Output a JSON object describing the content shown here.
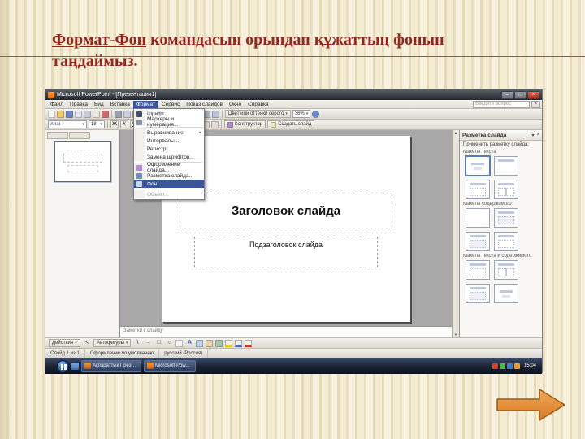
{
  "heading": {
    "link_text": "Формат-Фон",
    "rest_text": " командасын орындап құжаттың фонын таңдаймыз."
  },
  "icons": {
    "minimize": "–",
    "maximize": "□",
    "close": "×",
    "doc_close": "×",
    "dropdown_caret": "▾",
    "submenu_arrow": "▸",
    "bold": "Ж",
    "italic": "К",
    "underline": "Ч",
    "shadow": "S",
    "pointer": "↖",
    "line": "\\",
    "arrow": "→",
    "rect": "□",
    "oval": "○",
    "wordart": "А",
    "scroll_up": "▲",
    "scroll_down": "▼"
  },
  "window": {
    "title": "Microsoft PowerPoint - [Презентация1]",
    "help_placeholder": "Введите вопрос",
    "menu": {
      "items": [
        "Файл",
        "Правка",
        "Вид",
        "Вставка",
        "Формат",
        "Сервис",
        "Показ слайдов",
        "Окно",
        "Справка"
      ]
    },
    "format_menu": {
      "items": [
        "Шрифт...",
        "Маркеры и нумерация...",
        "Выравнивание",
        "Интервалы...",
        "Регистр...",
        "Замена шрифтов...",
        "Оформление слайда...",
        "Разметка слайда...",
        "Фон...",
        "Объект..."
      ]
    },
    "toolbar": {
      "font_name": "Arial",
      "font_size": "18",
      "zoom": "36%",
      "color_mode": "Цвет или оттенки серого",
      "design": "Конструктор",
      "new_slide": "Создать слайд"
    },
    "canvas": {
      "title_placeholder": "Заголовок слайда",
      "subtitle_placeholder": "Подзаголовок слайда"
    },
    "notes_label": "Заметки к слайду",
    "task_pane": {
      "title": "Разметка слайда",
      "apply_label": "Применить разметку слайда:",
      "sections": [
        "Макеты текста",
        "Макеты содержимого",
        "Макеты текста и содержимого"
      ]
    },
    "drawbar": {
      "actions": "Действия",
      "autoshapes": "Автофигуры"
    },
    "status": {
      "slide": "Слайд 1 из 1",
      "design": "Оформление по умолчанию",
      "language": "русский (Россия)"
    }
  },
  "os_taskbar": {
    "buttons": [
      {
        "label": "Ақпараттық Презент..."
      },
      {
        "label": "Microsoft Pow..."
      }
    ],
    "clock": "15:04"
  }
}
